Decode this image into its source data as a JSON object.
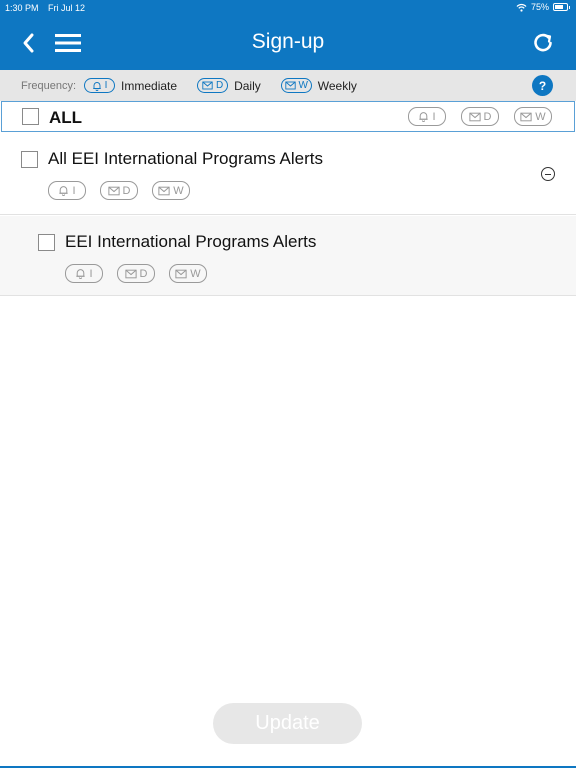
{
  "status": {
    "time": "1:30 PM",
    "date": "Fri Jul 12",
    "battery": "75%",
    "battery_level": 0.75
  },
  "nav": {
    "title": "Sign-up"
  },
  "frequency": {
    "label": "Frequency:",
    "options": [
      {
        "letter": "I",
        "name": "Immediate",
        "icon": "bell-icon"
      },
      {
        "letter": "D",
        "name": "Daily",
        "icon": "mail-icon"
      },
      {
        "letter": "W",
        "name": "Weekly",
        "icon": "mail-icon"
      }
    ],
    "help": "?"
  },
  "all_row": {
    "label": "ALL",
    "pills": [
      "I",
      "D",
      "W"
    ]
  },
  "groups": [
    {
      "name": "All EEI International Programs Alerts",
      "pills": [
        "I",
        "D",
        "W"
      ]
    },
    {
      "name": "EEI International Programs Alerts",
      "pills": [
        "I",
        "D",
        "W"
      ]
    }
  ],
  "update_label": "Update",
  "colors": {
    "brand": "#0e77c2",
    "disabled_button": "#e7e7e7"
  }
}
